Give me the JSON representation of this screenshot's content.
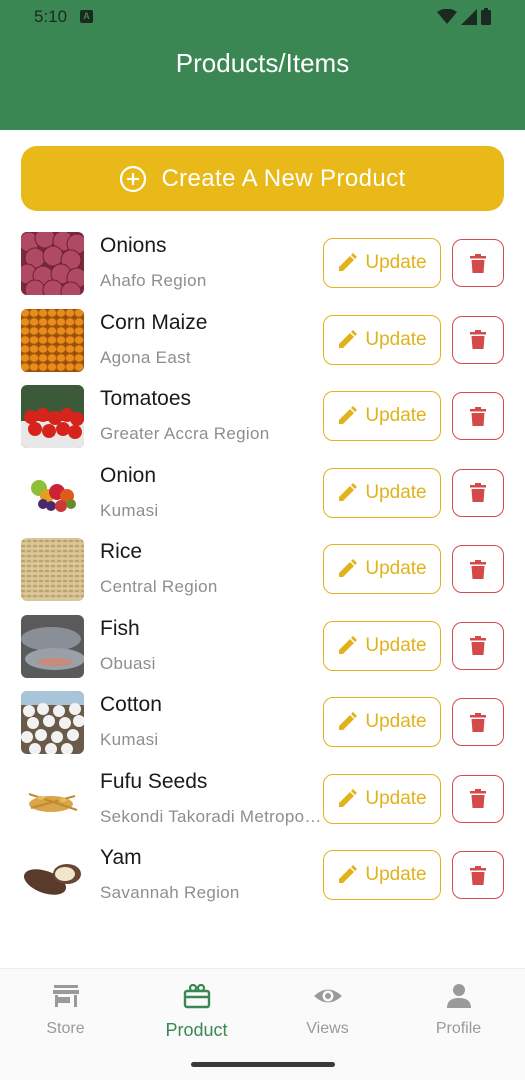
{
  "status_bar": {
    "time": "5:10",
    "badge": "A"
  },
  "header": {
    "title": "Products/Items"
  },
  "create_button": {
    "label": "Create A New Product"
  },
  "update_label": "Update",
  "products": [
    {
      "name": "Onions",
      "location": "Ahafo Region",
      "image": "onions"
    },
    {
      "name": "Corn Maize",
      "location": "Agona East",
      "image": "corn"
    },
    {
      "name": "Tomatoes",
      "location": "Greater Accra Region",
      "image": "tomatoes"
    },
    {
      "name": "Onion",
      "location": "Kumasi",
      "image": "fruits"
    },
    {
      "name": "Rice",
      "location": "Central Region",
      "image": "rice"
    },
    {
      "name": "Fish",
      "location": "Obuasi",
      "image": "fish"
    },
    {
      "name": "Cotton",
      "location": "Kumasi",
      "image": "cotton"
    },
    {
      "name": "Fufu Seeds",
      "location": "Sekondi Takoradi Metropolitan",
      "image": "seeds"
    },
    {
      "name": "Yam",
      "location": "Savannah Region",
      "image": "yam"
    }
  ],
  "bottom_nav": [
    {
      "label": "Store",
      "icon": "store-icon",
      "active": false
    },
    {
      "label": "Product",
      "icon": "product-icon",
      "active": true
    },
    {
      "label": "Views",
      "icon": "eye-icon",
      "active": false
    },
    {
      "label": "Profile",
      "icon": "person-icon",
      "active": false
    }
  ],
  "colors": {
    "header": "#3a8753",
    "accent": "#e8b919",
    "update": "#e1b21c",
    "delete": "#d44a4a",
    "nav_active": "#3a8753"
  }
}
